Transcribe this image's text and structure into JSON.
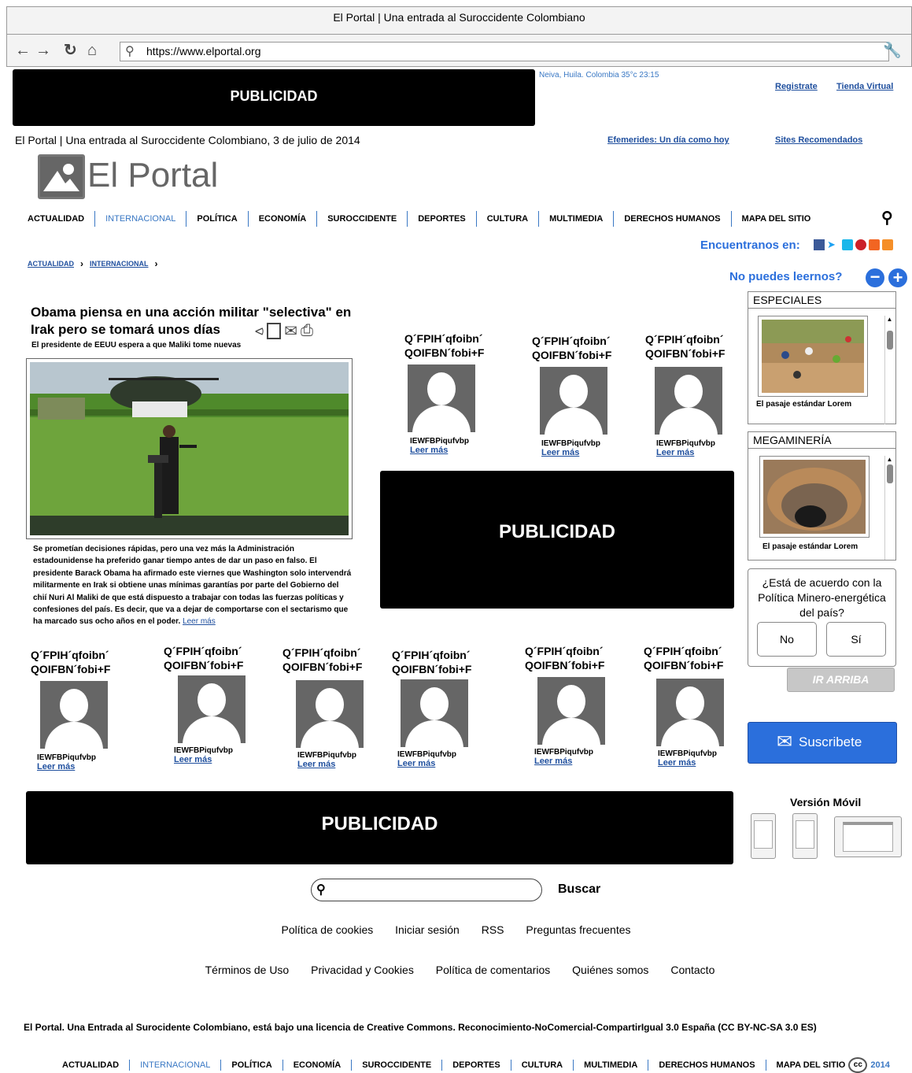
{
  "browser": {
    "title": "El Portal | Una entrada al Suroccidente Colombiano",
    "url": "https://www.elportal.org"
  },
  "ad_label": "PUBLICIDAD",
  "weather": "Neiva, Huila. Colombia  35°c  23:15",
  "top_links": [
    "Registrate",
    "Tienda Virtual"
  ],
  "dateline": "El Portal | Una entrada al Suroccidente Colombiano, 3 de julio de 2014",
  "secondary_links": [
    "Efemerides: Un día como hoy",
    "Sites Recomendados"
  ],
  "logo_text": "El Portal",
  "menu": [
    "ACTUALIDAD",
    "INTERNACIONAL",
    "POLÍTICA",
    "ECONOMÍA",
    "SUROCCIDENTE",
    "DEPORTES",
    "CULTURA",
    "MULTIMEDIA",
    "DERECHOS HUMANOS",
    "MAPA DEL SITIO"
  ],
  "menu_active": "INTERNACIONAL",
  "social_label": "Encuentranos en:",
  "breadcrumb": [
    "ACTUALIDAD",
    "INTERNACIONAL"
  ],
  "cant_read": "No puedes leernos?",
  "article": {
    "title": "Obama piensa en una acción militar \"selectiva\" en Irak pero se tomará unos días",
    "subtitle": "El presidente de EEUU espera a que Maliki tome nuevas",
    "body": "Se prometían decisiones rápidas, pero una vez más la Administración estadounidense ha preferido ganar tiempo antes de dar un paso en falso. El presidente Barack Obama ha afirmado este viernes que Washington solo intervendrá militarmente en Irak si obtiene unas mínimas garantías por parte del Gobierno del chií Nuri Al Maliki de que está dispuesto a trabajar con todas las fuerzas políticas y confesiones del país. Es decir, que va a dejar de comportarse con el sectarismo que ha marcado sus ocho años en el poder.",
    "more": "Leer más"
  },
  "profile": {
    "title": "Q´FPIH´qfoibn´ QOIFBN´fobi+F",
    "name": "IEWFBPiqufvbp",
    "more": "Leer más"
  },
  "sidebar": {
    "especiales": {
      "heading": "ESPECIALES",
      "caption": "El pasaje estándar Lorem"
    },
    "megamineria": {
      "heading": "MEGAMINERÍA",
      "caption": "El pasaje estándar Lorem"
    },
    "poll": {
      "question": "¿Está de acuerdo con la Política Minero-energética del país?",
      "no": "No",
      "yes": "Sí"
    },
    "top_button": "IR ARRIBA",
    "subscribe": "Suscribete",
    "mobile": "Versión Móvil"
  },
  "search_button": "Buscar",
  "footer_links_1": [
    "Política de cookies",
    "Iniciar sesión",
    "RSS",
    "Preguntas frecuentes"
  ],
  "footer_links_2": [
    "Términos de Uso",
    "Privacidad y Cookies",
    "Política de comentarios",
    "Quiénes somos",
    "Contacto"
  ],
  "license": "El Portal. Una Entrada al Surocidente Colombiano, está bajo una licencia de Creative Commons. Reconocimiento-NoComercial-CompartirIgual 3.0 España (CC BY-NC-SA 3.0 ES)",
  "year": "2014",
  "colors": {
    "link": "#1f4f9e",
    "accent": "#3a78c4",
    "subscribe": "#2b6fdc"
  }
}
